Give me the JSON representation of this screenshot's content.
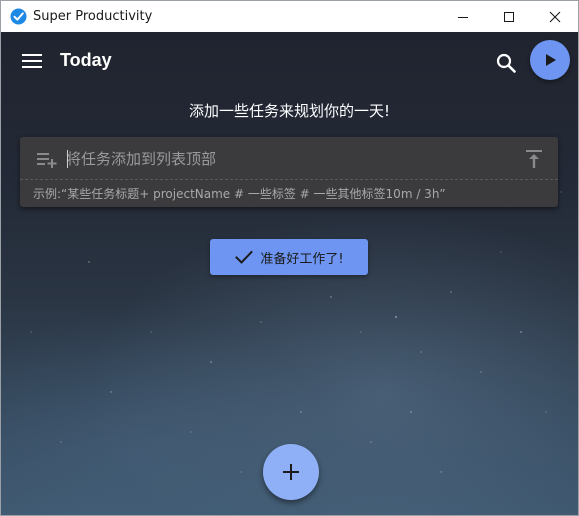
{
  "window": {
    "title": "Super Productivity",
    "controls": {
      "minimize": "minimize",
      "maximize": "maximize",
      "close": "close"
    }
  },
  "header": {
    "title": "Today",
    "menu_icon": "hamburger-menu-icon",
    "search_icon": "search-icon",
    "play_icon": "play-icon"
  },
  "main": {
    "heading": "添加一些任务来规划你的一天!",
    "add_task": {
      "placeholder": "将任务添加到列表顶部",
      "value": "",
      "hint": "示例:“某些任务标题+ projectName # 一些标签 # 一些其他标签10m / 3h”",
      "leading_icon": "playlist-add-icon",
      "add_to_top_icon": "vertical-align-top-icon"
    },
    "ready_button": {
      "label": "准备好工作了!",
      "icon": "check-icon"
    },
    "fab": {
      "icon": "plus-icon"
    }
  },
  "colors": {
    "accent": "#6d95f1",
    "fab": "#8fb0f7",
    "add_task_bg": "#3b3b3e"
  }
}
